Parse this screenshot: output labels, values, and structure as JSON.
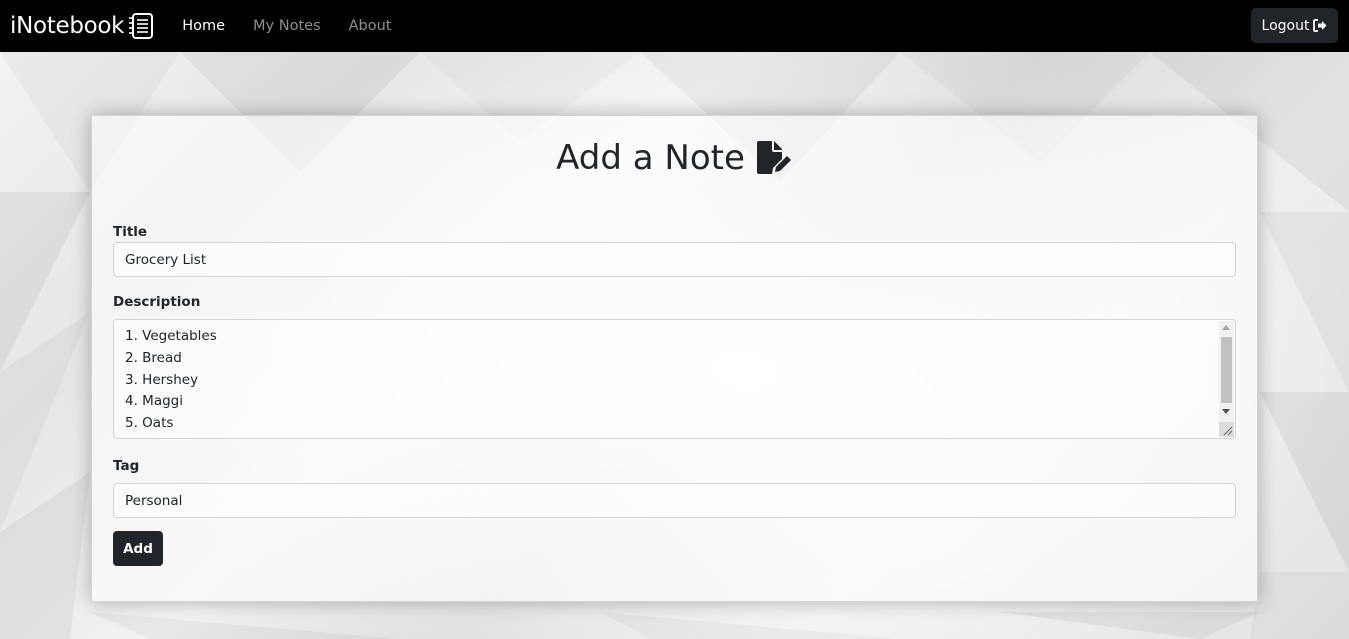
{
  "navbar": {
    "brand": "iNotebook",
    "links": [
      {
        "label": "Home",
        "active": true
      },
      {
        "label": "My Notes",
        "active": false
      },
      {
        "label": "About",
        "active": false
      }
    ],
    "logout_label": "Logout"
  },
  "form": {
    "heading": "Add a Note",
    "title_label": "Title",
    "title_value": "Grocery List",
    "description_label": "Description",
    "description_lines": [
      "1. Vegetables",
      "2. Bread",
      "3. Hershey",
      "4. Maggi",
      "5. Oats"
    ],
    "tag_label": "Tag",
    "tag_value": "Personal",
    "add_label": "Add"
  },
  "icons": {
    "brand": "notebook-icon",
    "heading": "file-pen-icon",
    "logout": "sign-out-icon"
  },
  "colors": {
    "navbar_bg": "#000000",
    "button_dark": "#212529",
    "nav_inactive": "rgba(255,255,255,0.55)"
  }
}
